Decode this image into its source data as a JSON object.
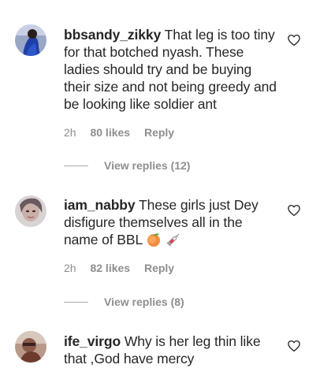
{
  "comments": [
    {
      "username": "bbsandy_zikky",
      "text": "That leg is too tiny for that botched nyash. These ladies should try and be buying their size and not being greedy and be looking like soldier ant",
      "time": "2h",
      "likes": "80 likes",
      "reply": "Reply",
      "view_replies": "View replies (12)",
      "avatar_icon": "user-avatar"
    },
    {
      "username": "iam_nabby",
      "text": "These girls just Dey disfigure themselves all in the name of BBL",
      "emojis": [
        "peach-emoji",
        "syringe-emoji"
      ],
      "time": "2h",
      "likes": "82 likes",
      "reply": "Reply",
      "view_replies": "View replies (8)",
      "avatar_icon": "user-avatar"
    },
    {
      "username": "ife_virgo",
      "text": "Why is her leg thin like that ,God have mercy",
      "avatar_icon": "user-avatar"
    }
  ],
  "icons": {
    "like": "heart-outline-icon"
  },
  "colors": {
    "text": "#262626",
    "muted": "#8e8e8e"
  }
}
